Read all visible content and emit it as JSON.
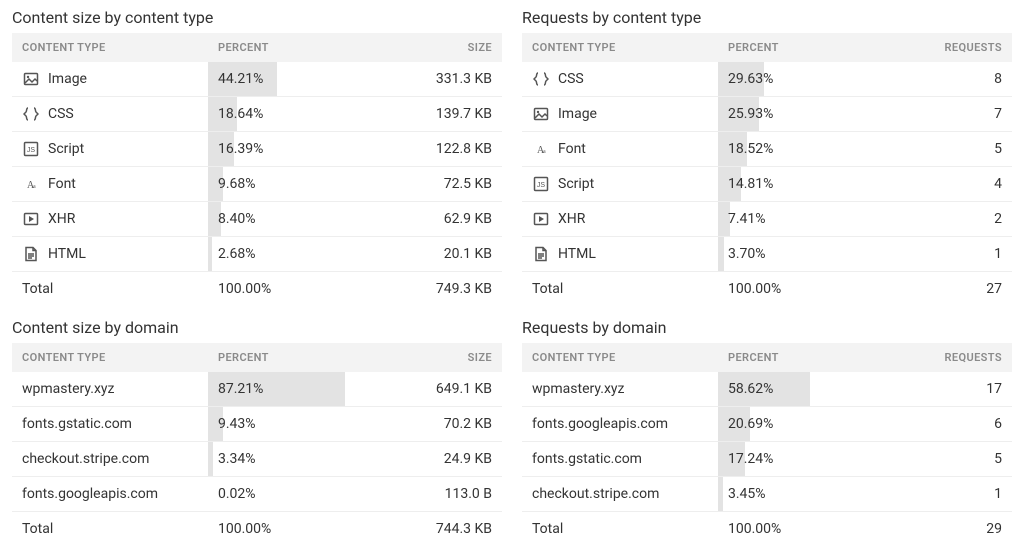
{
  "panels": [
    {
      "title": "Content size by content type",
      "headers": [
        "CONTENT TYPE",
        "PERCENT",
        "SIZE"
      ],
      "rows": [
        {
          "icon": "image-icon",
          "label": "Image",
          "percent": "44.21%",
          "pct_num": 44.21,
          "value": "331.3 KB"
        },
        {
          "icon": "css-icon",
          "label": "CSS",
          "percent": "18.64%",
          "pct_num": 18.64,
          "value": "139.7 KB"
        },
        {
          "icon": "script-icon",
          "label": "Script",
          "percent": "16.39%",
          "pct_num": 16.39,
          "value": "122.8 KB"
        },
        {
          "icon": "font-icon",
          "label": "Font",
          "percent": "9.68%",
          "pct_num": 9.68,
          "value": "72.5 KB"
        },
        {
          "icon": "xhr-icon",
          "label": "XHR",
          "percent": "8.40%",
          "pct_num": 8.4,
          "value": "62.9 KB"
        },
        {
          "icon": "html-icon",
          "label": "HTML",
          "percent": "2.68%",
          "pct_num": 2.68,
          "value": "20.1 KB"
        }
      ],
      "total": {
        "label": "Total",
        "percent": "100.00%",
        "value": "749.3 KB"
      }
    },
    {
      "title": "Requests by content type",
      "headers": [
        "CONTENT TYPE",
        "PERCENT",
        "REQUESTS"
      ],
      "rows": [
        {
          "icon": "css-icon",
          "label": "CSS",
          "percent": "29.63%",
          "pct_num": 29.63,
          "value": "8"
        },
        {
          "icon": "image-icon",
          "label": "Image",
          "percent": "25.93%",
          "pct_num": 25.93,
          "value": "7"
        },
        {
          "icon": "font-icon",
          "label": "Font",
          "percent": "18.52%",
          "pct_num": 18.52,
          "value": "5"
        },
        {
          "icon": "script-icon",
          "label": "Script",
          "percent": "14.81%",
          "pct_num": 14.81,
          "value": "4"
        },
        {
          "icon": "xhr-icon",
          "label": "XHR",
          "percent": "7.41%",
          "pct_num": 7.41,
          "value": "2"
        },
        {
          "icon": "html-icon",
          "label": "HTML",
          "percent": "3.70%",
          "pct_num": 3.7,
          "value": "1"
        }
      ],
      "total": {
        "label": "Total",
        "percent": "100.00%",
        "value": "27"
      }
    },
    {
      "title": "Content size by domain",
      "headers": [
        "CONTENT TYPE",
        "PERCENT",
        "SIZE"
      ],
      "rows": [
        {
          "icon": null,
          "label": "wpmastery.xyz",
          "percent": "87.21%",
          "pct_num": 87.21,
          "value": "649.1 KB"
        },
        {
          "icon": null,
          "label": "fonts.gstatic.com",
          "percent": "9.43%",
          "pct_num": 9.43,
          "value": "70.2 KB"
        },
        {
          "icon": null,
          "label": "checkout.stripe.com",
          "percent": "3.34%",
          "pct_num": 3.34,
          "value": "24.9 KB"
        },
        {
          "icon": null,
          "label": "fonts.googleapis.com",
          "percent": "0.02%",
          "pct_num": 0.02,
          "value": "113.0 B"
        }
      ],
      "total": {
        "label": "Total",
        "percent": "100.00%",
        "value": "744.3 KB"
      }
    },
    {
      "title": "Requests by domain",
      "headers": [
        "CONTENT TYPE",
        "PERCENT",
        "REQUESTS"
      ],
      "rows": [
        {
          "icon": null,
          "label": "wpmastery.xyz",
          "percent": "58.62%",
          "pct_num": 58.62,
          "value": "17"
        },
        {
          "icon": null,
          "label": "fonts.googleapis.com",
          "percent": "20.69%",
          "pct_num": 20.69,
          "value": "6"
        },
        {
          "icon": null,
          "label": "fonts.gstatic.com",
          "percent": "17.24%",
          "pct_num": 17.24,
          "value": "5"
        },
        {
          "icon": null,
          "label": "checkout.stripe.com",
          "percent": "3.45%",
          "pct_num": 3.45,
          "value": "1"
        }
      ],
      "total": {
        "label": "Total",
        "percent": "100.00%",
        "value": "29"
      }
    }
  ],
  "icons": {
    "image-icon": "image",
    "css-icon": "css",
    "script-icon": "script",
    "font-icon": "font",
    "xhr-icon": "xhr",
    "html-icon": "html"
  }
}
